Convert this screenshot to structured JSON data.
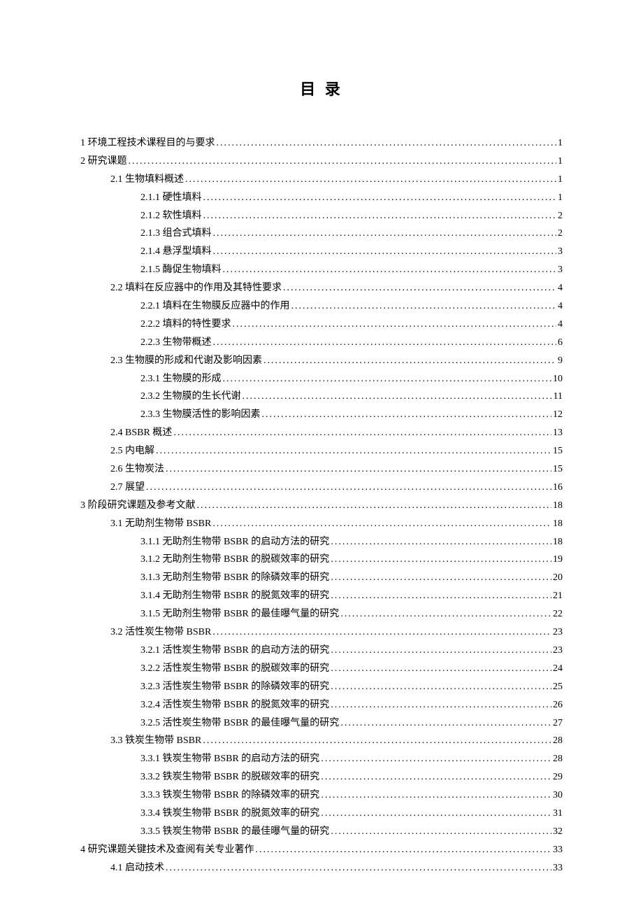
{
  "title": "目 录",
  "toc": [
    {
      "level": 0,
      "label": "1 环境工程技术课程目的与要求",
      "page": "1"
    },
    {
      "level": 0,
      "label": "2 研究课题",
      "page": "1"
    },
    {
      "level": 1,
      "label": "2.1 生物填料概述",
      "page": "1"
    },
    {
      "level": 2,
      "label": "2.1.1 硬性填料",
      "page": "1"
    },
    {
      "level": 2,
      "label": "2.1.2 软性填料",
      "page": "2"
    },
    {
      "level": 2,
      "label": "2.1.3 组合式填料",
      "page": "2"
    },
    {
      "level": 2,
      "label": "2.1.4 悬浮型填料",
      "page": "3"
    },
    {
      "level": 2,
      "label": "2.1.5 酶促生物填料",
      "page": "3"
    },
    {
      "level": 1,
      "label": "2.2 填料在反应器中的作用及其特性要求",
      "page": "4"
    },
    {
      "level": 2,
      "label": "2.2.1 填料在生物膜反应器中的作用",
      "page": "4"
    },
    {
      "level": 2,
      "label": "2.2.2 填料的特性要求",
      "page": "4"
    },
    {
      "level": 2,
      "label": "2.2.3 生物带概述",
      "page": "6"
    },
    {
      "level": 1,
      "label": "2.3 生物膜的形成和代谢及影响因素",
      "page": "9"
    },
    {
      "level": 2,
      "label": "2.3.1 生物膜的形成",
      "page": "10"
    },
    {
      "level": 2,
      "label": "2.3.2 生物膜的生长代谢",
      "page": "11"
    },
    {
      "level": 2,
      "label": "2.3.3 生物膜活性的影响因素",
      "page": "12"
    },
    {
      "level": 1,
      "label": "2.4 BSBR 概述",
      "page": "13"
    },
    {
      "level": 1,
      "label": "2.5 内电解",
      "page": "15"
    },
    {
      "level": 1,
      "label": "2.6 生物炭法",
      "page": "15"
    },
    {
      "level": 1,
      "label": "2.7 展望",
      "page": "16"
    },
    {
      "level": 0,
      "label": "3 阶段研究课题及参考文献",
      "page": "18"
    },
    {
      "level": 1,
      "label": "3.1 无助剂生物带 BSBR",
      "page": "18"
    },
    {
      "level": 2,
      "label": "3.1.1 无助剂生物带 BSBR 的启动方法的研究",
      "page": "18"
    },
    {
      "level": 2,
      "label": "3.1.2 无助剂生物带 BSBR 的脱碳效率的研究",
      "page": "19"
    },
    {
      "level": 2,
      "label": "3.1.3 无助剂生物带 BSBR 的除磷效率的研究",
      "page": "20"
    },
    {
      "level": 2,
      "label": "3.1.4 无助剂生物带 BSBR 的脱氮效率的研究",
      "page": "21"
    },
    {
      "level": 2,
      "label": "3.1.5 无助剂生物带 BSBR 的最佳曝气量的研究",
      "page": "22"
    },
    {
      "level": 1,
      "label": "3.2 活性炭生物带 BSBR",
      "page": "23"
    },
    {
      "level": 2,
      "label": "3.2.1 活性炭生物带 BSBR 的启动方法的研究",
      "page": "23"
    },
    {
      "level": 2,
      "label": "3.2.2 活性炭生物带 BSBR 的脱碳效率的研究",
      "page": "24"
    },
    {
      "level": 2,
      "label": "3.2.3 活性炭生物带 BSBR 的除磷效率的研究",
      "page": "25"
    },
    {
      "level": 2,
      "label": "3.2.4 活性炭生物带 BSBR 的脱氮效率的研究",
      "page": "26"
    },
    {
      "level": 2,
      "label": "3.2.5 活性炭生物带 BSBR 的最佳曝气量的研究",
      "page": "27"
    },
    {
      "level": 1,
      "label": "3.3 铁炭生物带 BSBR",
      "page": "28"
    },
    {
      "level": 2,
      "label": "3.3.1 铁炭生物带 BSBR 的启动方法的研究",
      "page": "28"
    },
    {
      "level": 2,
      "label": "3.3.2 铁炭生物带 BSBR 的脱碳效率的研究",
      "page": "29"
    },
    {
      "level": 2,
      "label": "3.3.3 铁炭生物带 BSBR 的除磷效率的研究",
      "page": "30"
    },
    {
      "level": 2,
      "label": "3.3.4 铁炭生物带 BSBR 的脱氮效率的研究",
      "page": "31"
    },
    {
      "level": 2,
      "label": "3.3.5 铁炭生物带 BSBR 的最佳曝气量的研究",
      "page": "32"
    },
    {
      "level": 0,
      "label": "4 研究课题关键技术及查阅有关专业著作",
      "page": "33"
    },
    {
      "level": 1,
      "label": "4.1 启动技术",
      "page": "33"
    }
  ]
}
